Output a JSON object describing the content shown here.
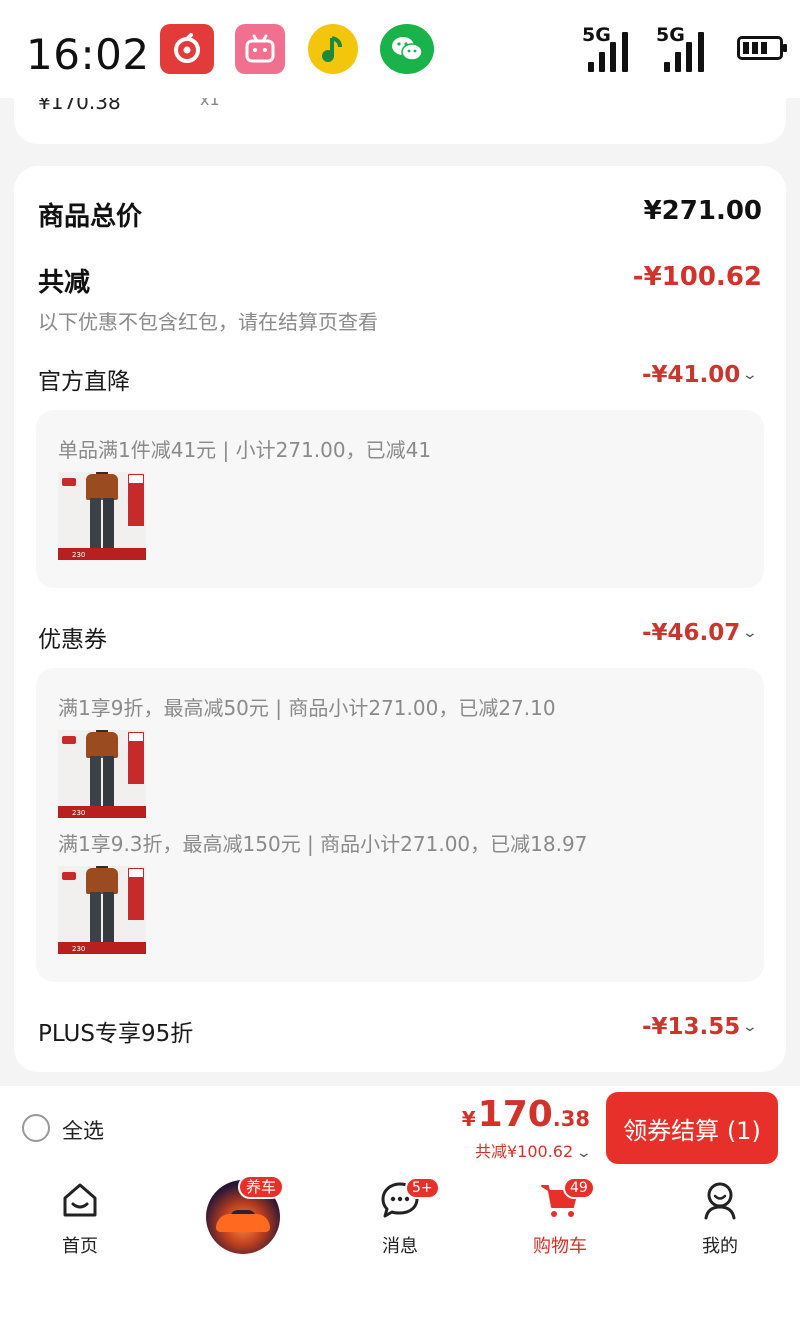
{
  "status_bar": {
    "time": "16:02",
    "apps": [
      "netease-music-icon",
      "bilibili-icon",
      "qq-music-icon",
      "wechat-icon"
    ],
    "signal_1": "5G",
    "signal_2": "5G",
    "battery_icon": "battery-icon"
  },
  "previous_item": {
    "price": "¥170.38",
    "qty": "x1"
  },
  "summary": {
    "goods_total_label": "商品总价",
    "goods_total_value": "¥271.00",
    "total_discount_label": "共减",
    "total_discount_value": "-¥100.62",
    "note": "以下优惠不包含红包，请在结算页查看",
    "official": {
      "label": "官方直降",
      "value": "-¥41.00",
      "rule": "单品满1件减41元 | 小计271.00，已减41"
    },
    "coupon": {
      "label": "优惠券",
      "value": "-¥46.07",
      "rules": [
        "满1享9折，最高减50元 | 商品小计271.00，已减27.10",
        "满1享9.3折，最高减150元 | 商品小计271.00，已减18.97"
      ]
    },
    "plus": {
      "label": "PLUS专享95折",
      "value": "-¥13.55"
    }
  },
  "checkout": {
    "select_all": "全选",
    "currency": "¥",
    "total_int": "170",
    "total_dec": ".38",
    "saving": "共减¥100.62",
    "pay_button": "领券结算 (1)"
  },
  "tabbar": {
    "home": "首页",
    "car_badge": "养车",
    "messages": "消息",
    "messages_badge": "5+",
    "cart": "购物车",
    "cart_badge": "49",
    "mine": "我的"
  },
  "colors": {
    "accent_red": "#e8302a",
    "discount_red": "#c8372d"
  }
}
